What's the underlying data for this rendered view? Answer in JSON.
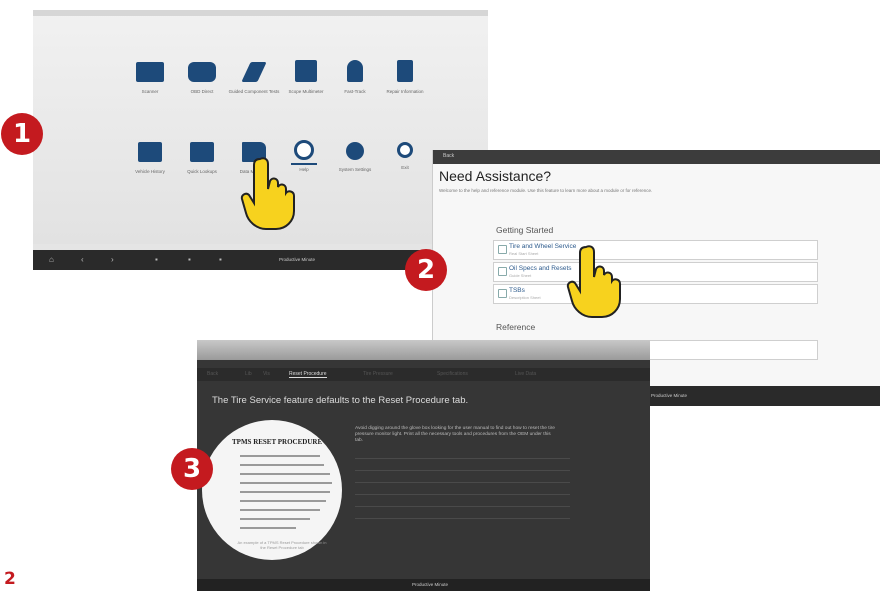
{
  "screen1": {
    "tiles_row1": [
      {
        "icon": "engine-icon",
        "label": "Scanner"
      },
      {
        "icon": "obd-icon",
        "label": "OBD Direct"
      },
      {
        "icon": "tools-icon",
        "label": "Guided Component Tests"
      },
      {
        "icon": "scope-icon",
        "label": "Scope Multimeter"
      },
      {
        "icon": "fixes-icon",
        "label": "Fast-Track"
      },
      {
        "icon": "repair-icon",
        "label": "Repair Information"
      }
    ],
    "tiles_row2": [
      {
        "icon": "vehicle-history-icon",
        "label": "Vehicle History"
      },
      {
        "icon": "book-icon",
        "label": "Quick Lookups"
      },
      {
        "icon": "folder-icon",
        "label": "Data Manager"
      },
      {
        "icon": "help-icon",
        "label": "Help"
      },
      {
        "icon": "gears-icon",
        "label": "System Settings"
      },
      {
        "icon": "power-icon",
        "label": "Exit"
      }
    ],
    "taskbar_text": "Productive Minute"
  },
  "screen2": {
    "header_back": "Back",
    "title": "Need Assistance?",
    "subtitle": "Welcome to the help and reference module. Use this feature to learn more about a module or for reference.",
    "section1": "Getting Started",
    "items": [
      {
        "title": "Tire and Wheel Service",
        "sub": "Real Start Sheet"
      },
      {
        "title": "Oil Specs and Resets",
        "sub": "Guide Sheet"
      },
      {
        "title": "TSBs",
        "sub": "Description Sheet"
      }
    ],
    "section2": "Reference",
    "taskbar_text": "Productive Minute"
  },
  "screen3": {
    "tabs": [
      "Back",
      "Lib",
      "Vis",
      "Reset Procedure",
      "Tire Pressure",
      "Specifications",
      "Live Data"
    ],
    "active_tab": "Reset Procedure",
    "heading": "The Tire Service feature defaults to the Reset Procedure tab.",
    "doc_title": "TPMS RESET PROCEDURE",
    "caption": "An example of a TPMS Reset Procedure shown in the Reset Procedure tab",
    "description": "Avoid digging around the glove box looking for the user manual to find out how to reset the tire pressure monitor light. Print all the necessary tools and procedures from the OEM under this tab.",
    "taskbar_text": "Productive Minute"
  },
  "badges": [
    "1",
    "2",
    "3"
  ],
  "page_number": "2",
  "colors": {
    "badge_red": "#c41a1f",
    "icon_blue": "#1d4a7a",
    "hand_yellow": "#f7d21e"
  }
}
